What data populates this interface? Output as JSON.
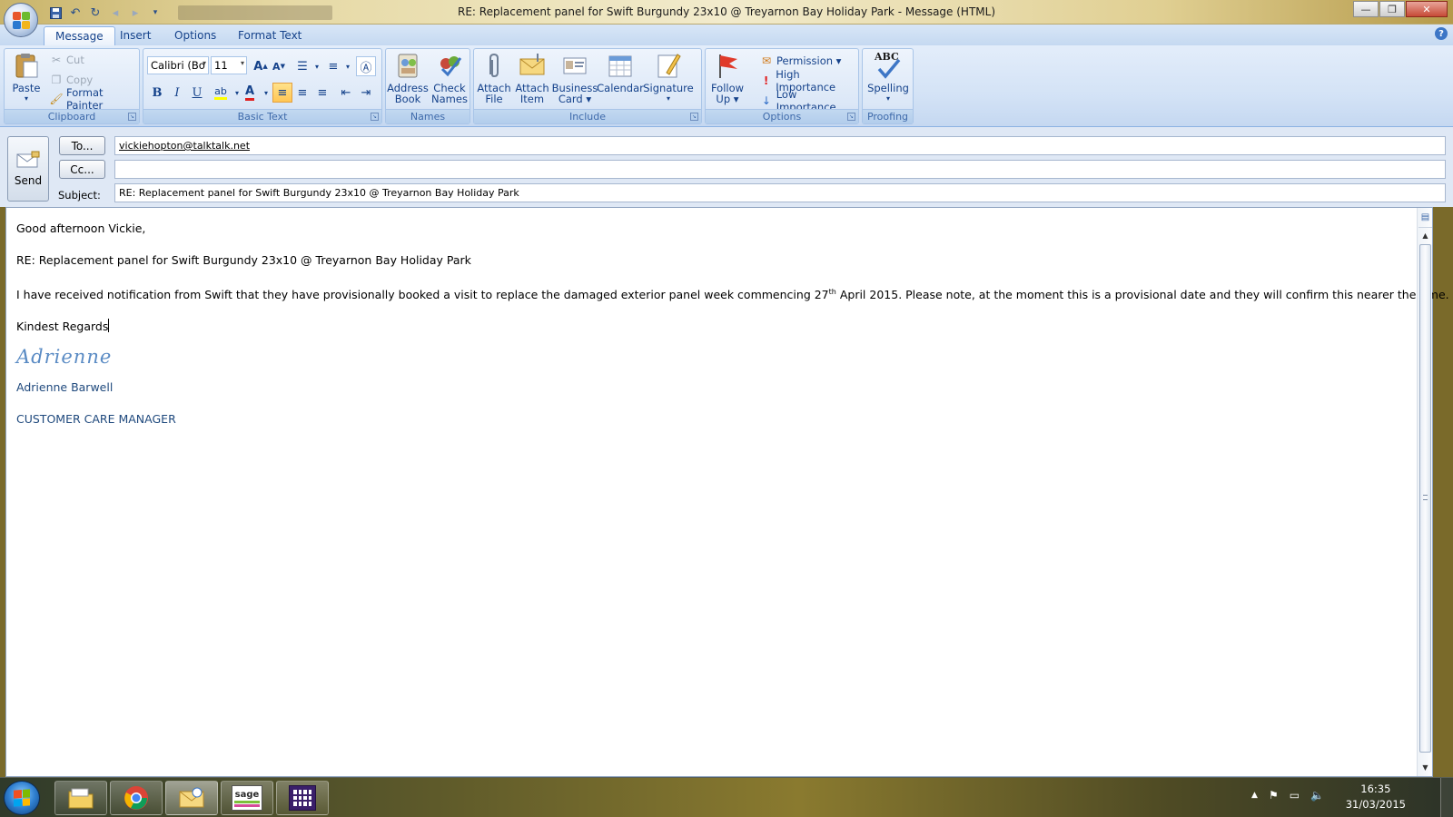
{
  "window": {
    "title": "RE: Replacement panel for Swift Burgundy 23x10 @ Treyarnon Bay Holiday Park - Message (HTML)",
    "minimize": "—",
    "maximize": "❐",
    "close": "✕"
  },
  "tabs": [
    {
      "label": "Message",
      "active": true
    },
    {
      "label": "Insert",
      "active": false
    },
    {
      "label": "Options",
      "active": false
    },
    {
      "label": "Format Text",
      "active": false
    }
  ],
  "help": "?",
  "ribbon": {
    "clipboard": {
      "label": "Clipboard",
      "paste": "Paste",
      "cut": "Cut",
      "copy": "Copy",
      "format_painter": "Format Painter"
    },
    "basic_text": {
      "label": "Basic Text",
      "font": "Calibri (Bo",
      "size": "11",
      "bold": "B",
      "italic": "I",
      "underline": "U"
    },
    "names": {
      "label": "Names",
      "address_book_1": "Address",
      "address_book_2": "Book",
      "check_names_1": "Check",
      "check_names_2": "Names"
    },
    "include": {
      "label": "Include",
      "attach_file_1": "Attach",
      "attach_file_2": "File",
      "attach_item_1": "Attach",
      "attach_item_2": "Item",
      "business_card_1": "Business",
      "business_card_2": "Card ▾",
      "calendar": "Calendar",
      "signature": "Signature"
    },
    "options": {
      "label": "Options",
      "follow_up_1": "Follow",
      "follow_up_2": "Up ▾",
      "permission": "Permission ▾",
      "high_importance": "High Importance",
      "low_importance": "Low Importance"
    },
    "proofing": {
      "label": "Proofing",
      "spelling": "Spelling",
      "abc": "ABC"
    }
  },
  "compose": {
    "send": "Send",
    "to_button": "To...",
    "cc_button": "Cc...",
    "subject_label": "Subject:",
    "to_value": "vickiehopton@talktalk.net",
    "cc_value": "",
    "subject_value": "RE: Replacement panel for Swift Burgundy 23x10 @ Treyarnon Bay Holiday Park"
  },
  "body": {
    "greeting": "Good afternoon Vickie,",
    "subject_line": "RE: Replacement panel for Swift Burgundy 23x10 @ Treyarnon Bay Holiday Park",
    "para_before": "I have received notification from Swift that they have provisionally booked a visit to replace the damaged exterior panel week commencing 27",
    "para_sup": "th",
    "para_after": " April 2015.  Please note, at the moment this is a provisional date and they will confirm this nearer the time.",
    "closing": "Kindest Regards",
    "signature_script": "Adrienne",
    "signature_name": "Adrienne Barwell",
    "signature_title": "CUSTOMER CARE MANAGER"
  },
  "taskbar": {
    "time": "16:35",
    "date": "31/03/2015",
    "sage_label": "sage"
  },
  "colors": {
    "ribbon_text": "#15428b",
    "signature_blue": "#1f497d",
    "signature_script": "#5a8bc4"
  }
}
